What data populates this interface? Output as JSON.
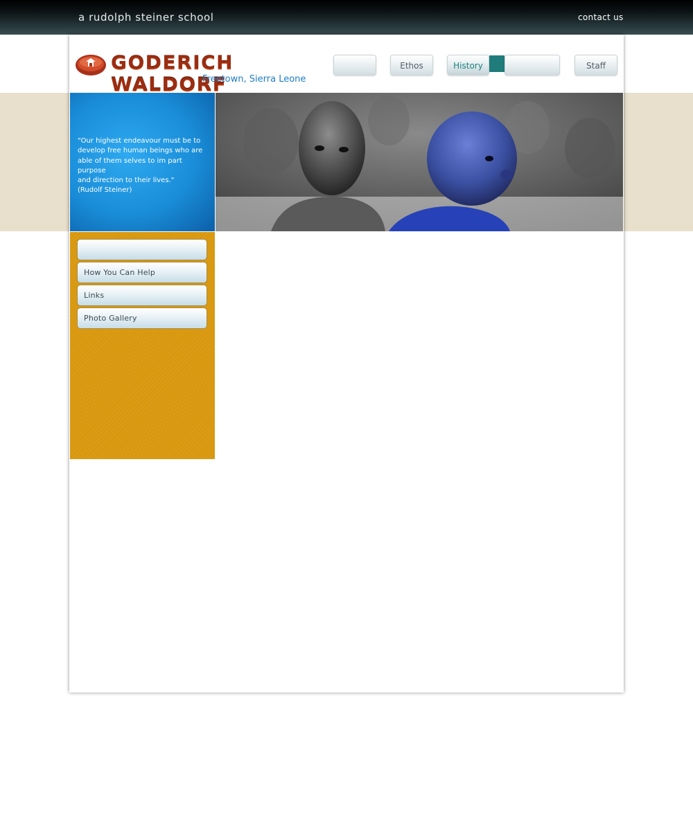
{
  "header": {
    "tagline": "a rudolph steiner school",
    "contact_label": "contact us"
  },
  "logo": {
    "title": "GODERICH WALDORF",
    "subtitle": "Freetown, Sierra Leone"
  },
  "nav": {
    "items": [
      {
        "label": ""
      },
      {
        "label": "Ethos"
      },
      {
        "label": "History"
      },
      {
        "label": ""
      },
      {
        "label": "Staff"
      }
    ],
    "active": "History"
  },
  "hero": {
    "quote_line1": "\"Our highest endeavour must be to",
    "quote_line2": "develop free human beings who are",
    "quote_line3": "able of them selves to im part purpose",
    "quote_line4": "and direction to their lives.\"",
    "quote_author": "(Rudolf Steiner)"
  },
  "sidebar": {
    "items": [
      {
        "label": ""
      },
      {
        "label": "How You Can Help"
      },
      {
        "label": "Links"
      },
      {
        "label": "Photo Gallery"
      }
    ]
  },
  "colors": {
    "topbar": "#0d1416",
    "band": "#e8dfcc",
    "quote_panel": "#1a8dd8",
    "sidebar": "#dc9d14",
    "accent_teal": "#1f7c7b",
    "logo_red": "#9a2d12",
    "logo_blue": "#1d7cc5"
  }
}
